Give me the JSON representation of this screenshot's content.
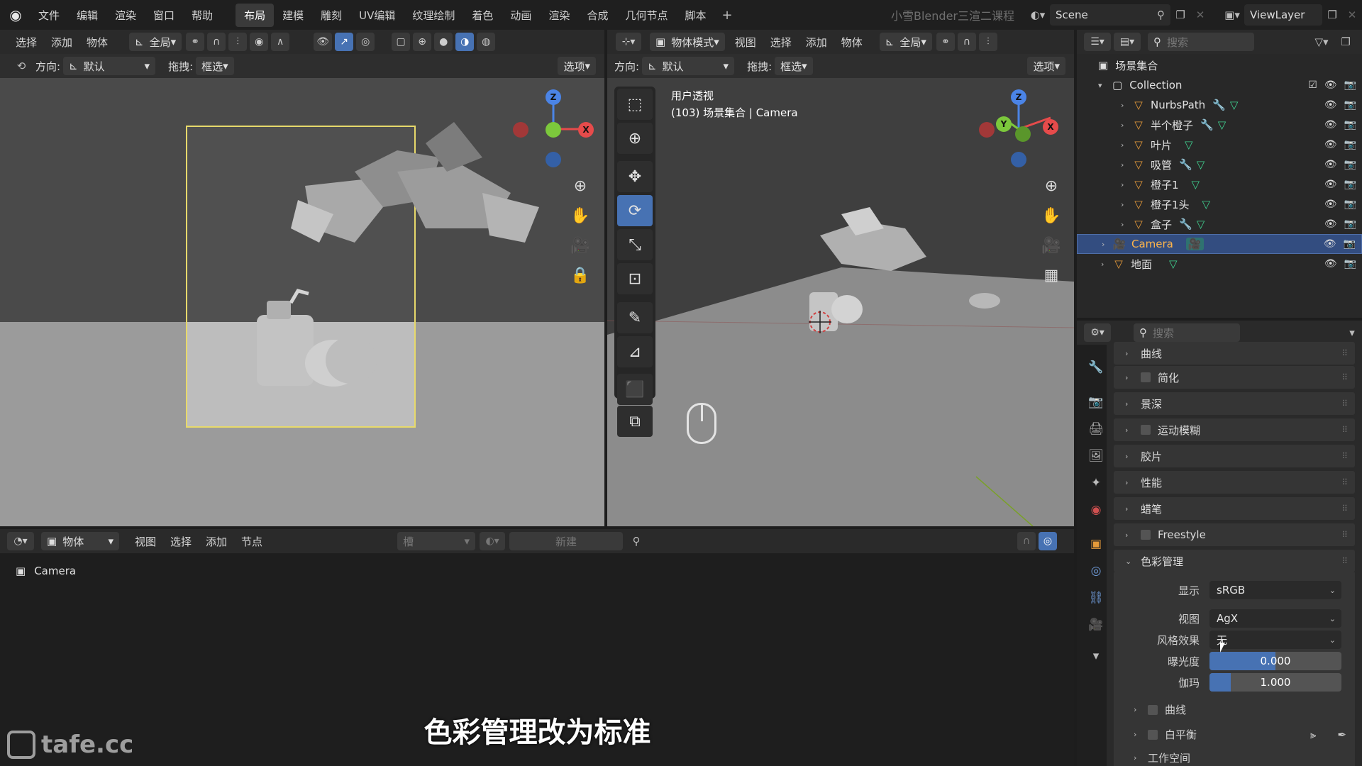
{
  "topbar": {
    "menus": [
      "文件",
      "编辑",
      "渲染",
      "窗口",
      "帮助"
    ],
    "workspaces": [
      "布局",
      "建模",
      "雕刻",
      "UV编辑",
      "纹理绘制",
      "着色",
      "动画",
      "渲染",
      "合成",
      "几何节点",
      "脚本"
    ],
    "active_workspace": "布局",
    "course_title": "小雪Blender三渲二课程",
    "scene": "Scene",
    "view_layer": "ViewLayer"
  },
  "viewport_left": {
    "menus": [
      "选择",
      "添加",
      "物体"
    ],
    "transform": "全局",
    "orientation_label": "方向:",
    "orientation_value": "默认",
    "drag_label": "拖拽:",
    "drag_value": "框选",
    "options": "选项"
  },
  "viewport_right": {
    "mode": "物体模式",
    "menus": [
      "视图",
      "选择",
      "添加",
      "物体"
    ],
    "transform": "全局",
    "orientation_label": "方向:",
    "orientation_value": "默认",
    "drag_label": "拖拽:",
    "drag_value": "框选",
    "options": "选项",
    "view_name": "用户透视",
    "view_info": "(103) 场景集合 | Camera"
  },
  "gizmo": {
    "x": "X",
    "y": "Y",
    "z": "Z"
  },
  "node_editor": {
    "type": "物体",
    "menus": [
      "视图",
      "选择",
      "添加",
      "节点"
    ],
    "slot": "槽",
    "new": "新建",
    "object_name": "Camera"
  },
  "outliner": {
    "search_placeholder": "搜索",
    "scene_collection": "场景集合",
    "collection": "Collection",
    "items": [
      {
        "name": "NurbsPath"
      },
      {
        "name": "半个橙子"
      },
      {
        "name": "叶片"
      },
      {
        "name": "吸管"
      },
      {
        "name": "橙子1"
      },
      {
        "name": "橙子1头"
      },
      {
        "name": "盒子"
      },
      {
        "name": "Camera"
      },
      {
        "name": "地面"
      }
    ]
  },
  "properties": {
    "search_placeholder": "搜索",
    "sections": [
      "曲线",
      "简化",
      "景深",
      "运动模糊",
      "胶片",
      "性能",
      "蜡笔",
      "Freestyle",
      "色彩管理"
    ],
    "color_management": {
      "display_label": "显示",
      "display_value": "sRGB",
      "view_label": "视图",
      "view_value": "AgX",
      "look_label": "风格效果",
      "look_value": "无",
      "exposure_label": "曝光度",
      "exposure_value": "0.000",
      "gamma_label": "伽玛",
      "gamma_value": "1.000"
    },
    "subsections": [
      "曲线",
      "白平衡",
      "工作空间"
    ]
  },
  "subtitle": "色彩管理改为标准",
  "watermark": "tafe.cc"
}
